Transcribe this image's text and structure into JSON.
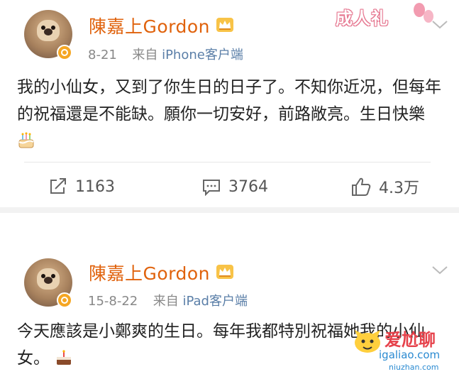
{
  "posts": [
    {
      "author": "陳嘉上Gordon",
      "date": "8-21",
      "via_prefix": "来自",
      "source": "iPhone客户端",
      "text": "我的小仙女，又到了你生日的日子了。不知你近况，但每年的祝福還是不能缺。願你一切安好，前路敞亮。生日快樂",
      "emoji": "cake-icon",
      "sticker_text": "成人礼",
      "actions": {
        "repost": "1163",
        "comments": "3764",
        "likes": "4.3万"
      }
    },
    {
      "author": "陳嘉上Gordon",
      "date": "15-8-22",
      "via_prefix": "来自",
      "source": "iPad客户端",
      "text": "今天應該是小鄭爽的生日。每年我都特別祝福她我的小仙女。",
      "emoji": "cake-icon"
    }
  ],
  "watermark": {
    "line1": "爱尬聊",
    "line2": "igaliao.com",
    "line3": "niuzhan.com"
  },
  "colors": {
    "name": "#e0620c",
    "source": "#5b7fa8",
    "badge": "#f5a623"
  }
}
